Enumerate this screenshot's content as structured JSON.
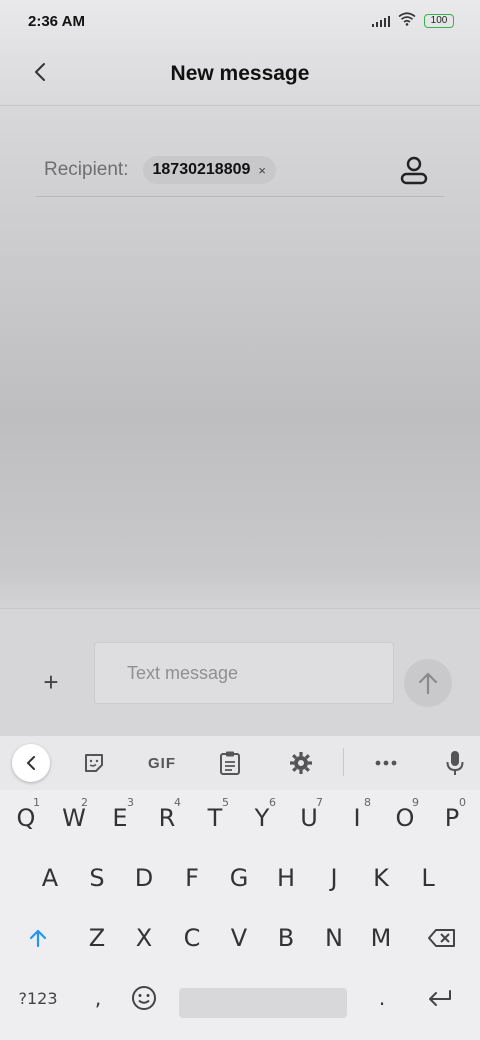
{
  "status_bar": {
    "time": "2:36 AM",
    "battery": "100",
    "icons": [
      "signal-icon",
      "wifi-icon",
      "battery-icon"
    ]
  },
  "header": {
    "title": "New message",
    "back_icon": "back-chevron-icon"
  },
  "recipient": {
    "label": "Recipient:",
    "chip": "18730218809",
    "chip_remove": "×",
    "contact_icon": "contact-icon"
  },
  "compose": {
    "add_icon": "+",
    "placeholder": "Text message",
    "send_icon": "send-arrow-icon"
  },
  "keyboard": {
    "toolbar": {
      "collapse_icon": "chevron-left-icon",
      "sticker_icon": "sticker-icon",
      "gif_label": "GIF",
      "clipboard_icon": "clipboard-icon",
      "settings_icon": "gear-icon",
      "more_icon": "more-icon",
      "mic_icon": "microphone-icon"
    },
    "row1": [
      {
        "key": "Q",
        "hint": "1"
      },
      {
        "key": "W",
        "hint": "2"
      },
      {
        "key": "E",
        "hint": "3"
      },
      {
        "key": "R",
        "hint": "4"
      },
      {
        "key": "T",
        "hint": "5"
      },
      {
        "key": "Y",
        "hint": "6"
      },
      {
        "key": "U",
        "hint": "7"
      },
      {
        "key": "I",
        "hint": "8"
      },
      {
        "key": "O",
        "hint": "9"
      },
      {
        "key": "P",
        "hint": "0"
      }
    ],
    "row2": [
      "A",
      "S",
      "D",
      "F",
      "G",
      "H",
      "J",
      "K",
      "L"
    ],
    "row3": [
      "Z",
      "X",
      "C",
      "V",
      "B",
      "N",
      "M"
    ],
    "row4": {
      "symbols": "?123",
      "comma": ",",
      "period": ".",
      "emoji_icon": "emoji-icon",
      "enter_icon": "enter-icon"
    },
    "accent_color": "#2196f3"
  }
}
